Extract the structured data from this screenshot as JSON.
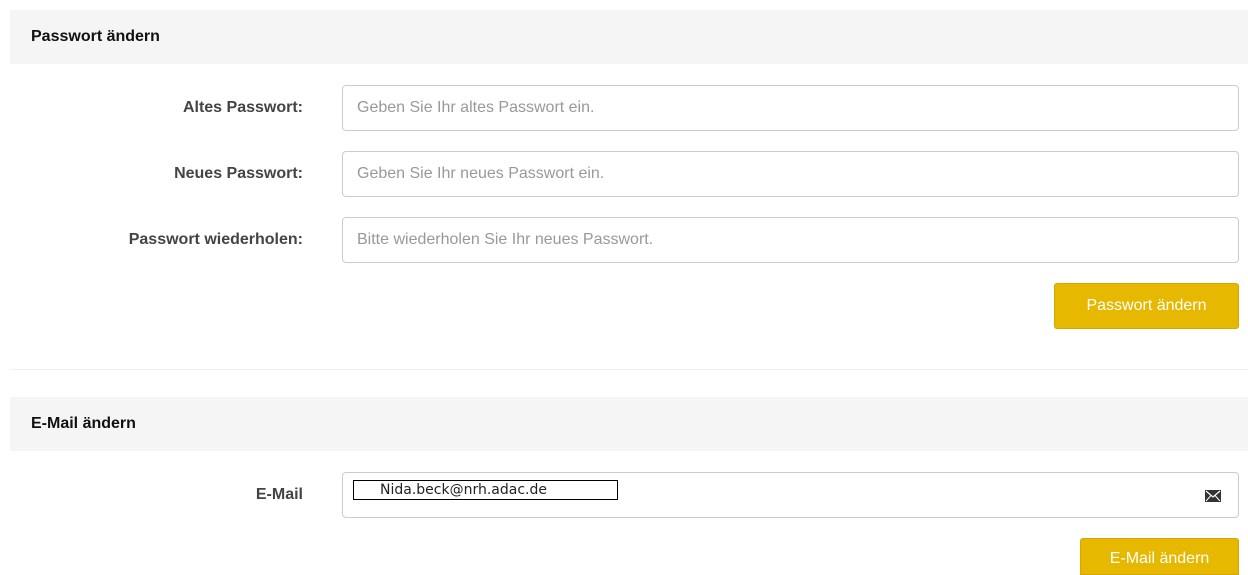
{
  "password_section": {
    "title": "Passwort ändern",
    "fields": [
      {
        "label": "Altes Passwort:",
        "placeholder": "Geben Sie Ihr altes Passwort ein."
      },
      {
        "label": "Neues Passwort:",
        "placeholder": "Geben Sie Ihr neues Passwort ein."
      },
      {
        "label": "Passwort wiederholen:",
        "placeholder": "Bitte wiederholen Sie Ihr neues Passwort."
      }
    ],
    "submit_label": "Passwort ändern"
  },
  "email_section": {
    "title": "E-Mail ändern",
    "label": "E-Mail",
    "value": "Nida.beck@nrh.adac.de",
    "icon": "envelope-icon",
    "submit_label": "E-Mail ändern"
  },
  "colors": {
    "accent": "#e6b800",
    "header_bg": "#f5f5f5"
  }
}
